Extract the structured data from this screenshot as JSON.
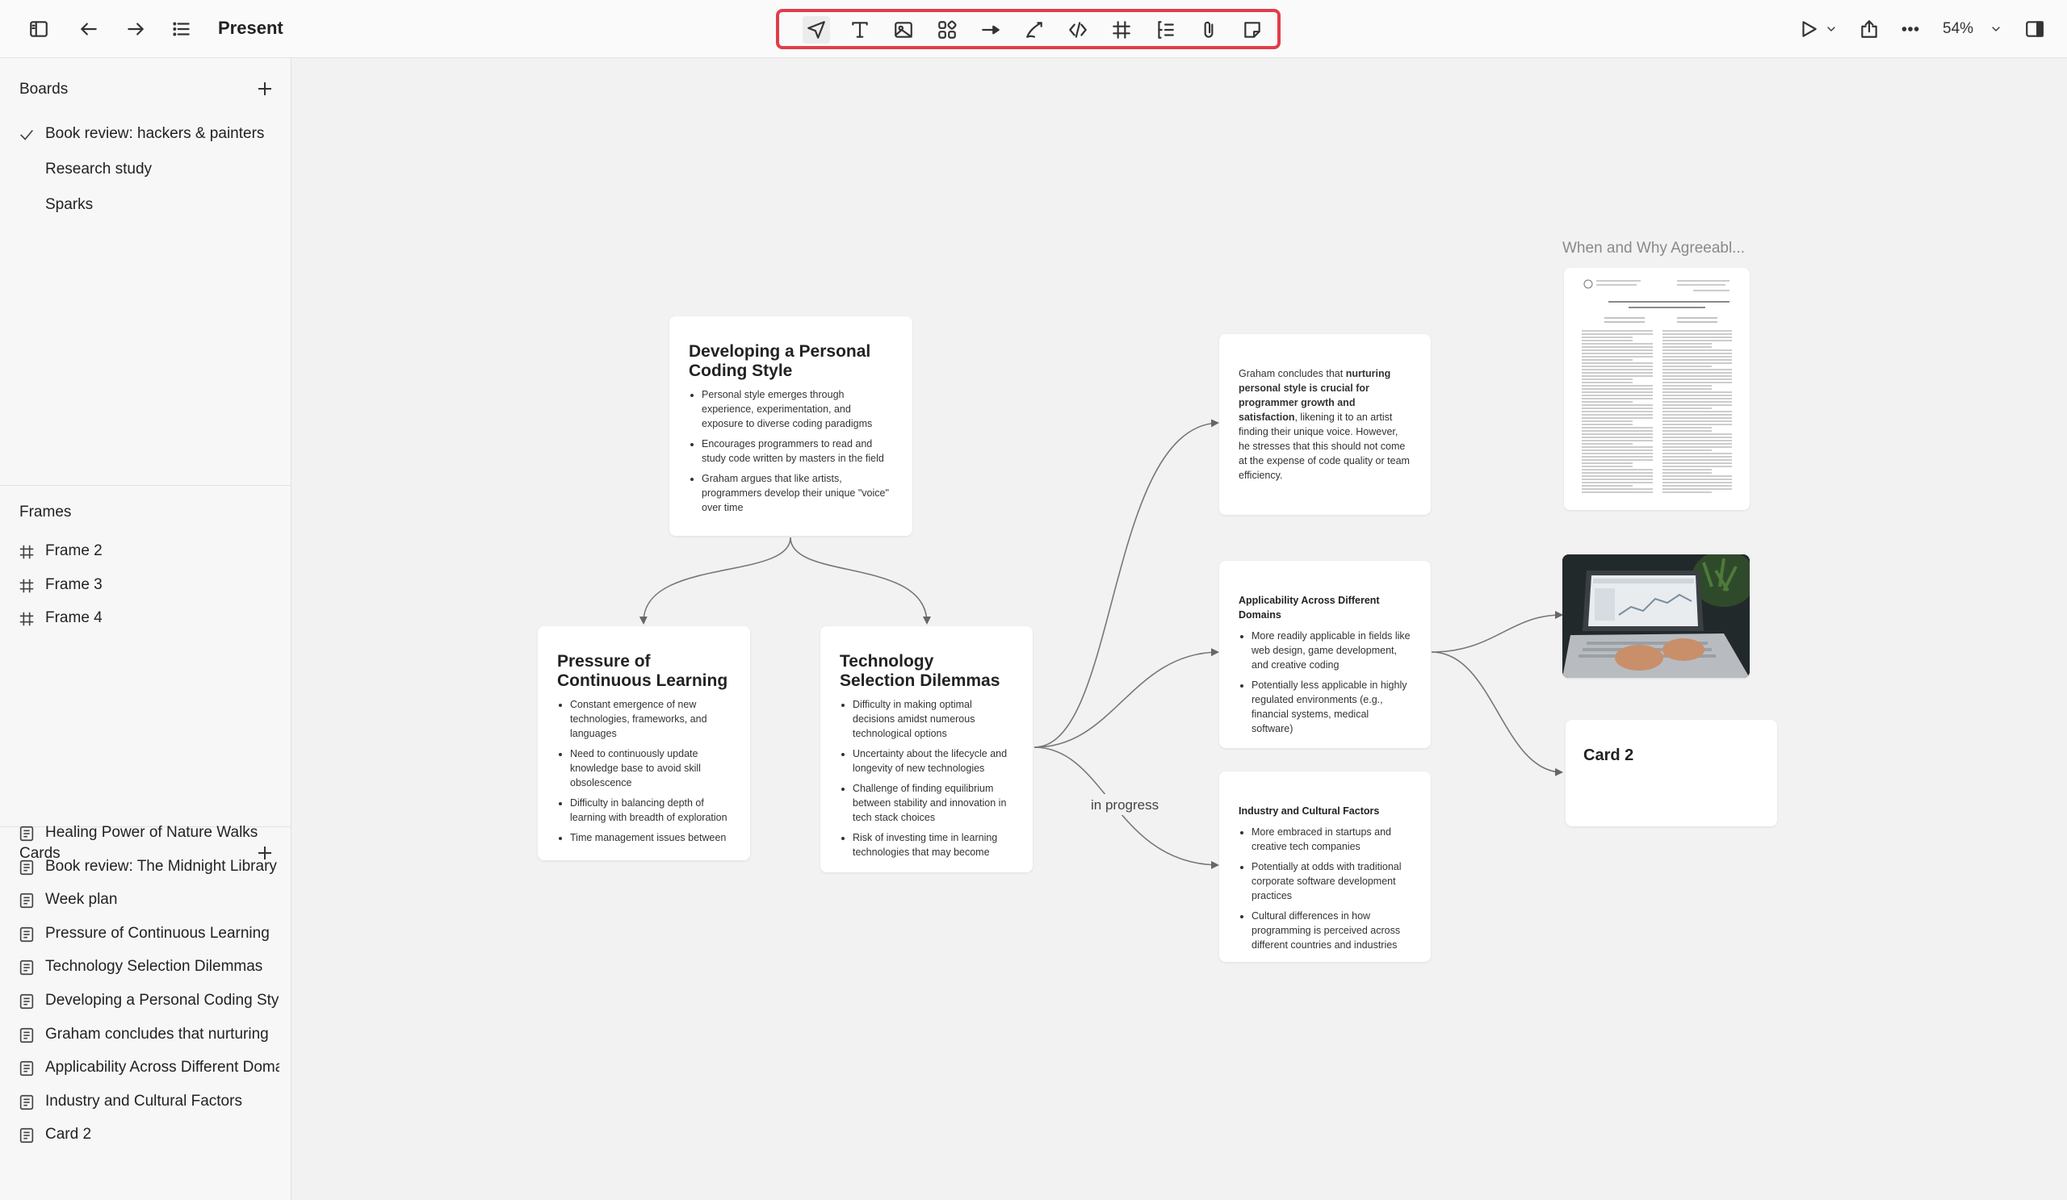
{
  "app": {
    "title": "Present",
    "zoom": "54%"
  },
  "toolbar": {
    "tools": [
      {
        "icon": "select-arrow-icon"
      },
      {
        "icon": "text-icon"
      },
      {
        "icon": "image-icon"
      },
      {
        "icon": "components-icon"
      },
      {
        "icon": "connector-arrow-icon"
      },
      {
        "icon": "pen-icon"
      },
      {
        "icon": "code-icon"
      },
      {
        "icon": "frame-icon"
      },
      {
        "icon": "outline-icon"
      },
      {
        "icon": "attachment-icon"
      },
      {
        "icon": "sticky-note-icon"
      }
    ]
  },
  "sidebar": {
    "boards_heading": "Boards",
    "boards": [
      {
        "label": "Book review:  hackers & painters",
        "selected": true
      },
      {
        "label": "Research study",
        "selected": false
      },
      {
        "label": "Sparks",
        "selected": false
      }
    ],
    "frames_heading": "Frames",
    "frames": [
      {
        "label": "Frame 2"
      },
      {
        "label": "Frame 3"
      },
      {
        "label": "Frame 4"
      }
    ],
    "cards_heading": "Cards",
    "cards": [
      {
        "label": "Healing Power of Nature Walks"
      },
      {
        "label": "Book review: The Midnight Library"
      },
      {
        "label": "Week plan"
      },
      {
        "label": "Pressure of Continuous Learning"
      },
      {
        "label": "Technology Selection Dilemmas"
      },
      {
        "label": "Developing a Personal Coding Style"
      },
      {
        "label": "Graham concludes that nurturing"
      },
      {
        "label": "Applicability Across Different Domains"
      },
      {
        "label": "Industry and Cultural Factors"
      },
      {
        "label": "Card 2"
      }
    ]
  },
  "canvas": {
    "card_style": {
      "title": "Developing a Personal Coding Style",
      "bullets": [
        "Personal style emerges through experience, experimentation, and exposure to diverse coding paradigms",
        "Encourages programmers to read and study code written by masters in the field",
        "Graham argues that like artists, programmers develop their unique \"voice\" over time"
      ]
    },
    "card_pressure": {
      "title": "Pressure of Continuous Learning",
      "bullets": [
        "Constant emergence of new technologies, frameworks, and languages",
        "Need to continuously update knowledge base to avoid skill obsolescence",
        "Difficulty in balancing depth of learning with breadth of exploration",
        "Time management issues between"
      ]
    },
    "card_tech": {
      "title": "Technology Selection Dilemmas",
      "bullets": [
        "Difficulty in making optimal decisions amidst numerous technological options",
        "Uncertainty about the lifecycle and longevity of new technologies",
        "Challenge of finding equilibrium between stability and innovation in tech stack choices",
        "Risk of investing time in learning technologies that may become"
      ]
    },
    "card_graham": {
      "text_pre": "Graham concludes that ",
      "text_bold": "nurturing personal style is crucial for programmer growth and satisfaction",
      "text_post": ", likening it to an artist finding their unique voice. However, he stresses that this should not come at the expense of code quality or team efficiency."
    },
    "card_applicability": {
      "title": "Applicability Across Different Domains",
      "bullets": [
        "More readily applicable in fields like web design, game development, and creative coding",
        "Potentially less applicable in highly regulated environments (e.g., financial systems, medical software)"
      ]
    },
    "card_industry": {
      "title": "Industry and Cultural Factors",
      "bullets": [
        "More embraced in startups and creative tech companies",
        "Potentially at odds with traditional corporate software development practices",
        "Cultural differences in how programming is perceived across different countries and industries"
      ]
    },
    "connector_label": "in progress",
    "pdf_title": "When and Why Agreeabl...",
    "card2_title": "Card 2"
  }
}
